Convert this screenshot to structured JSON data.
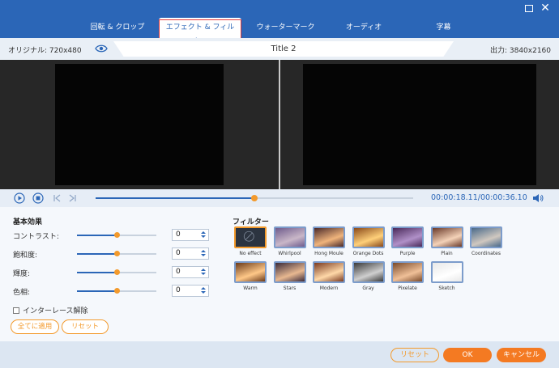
{
  "window": {
    "maximize_label": "□",
    "close_label": "✕"
  },
  "tabs": [
    {
      "label": "回転 & クロップ",
      "active": false
    },
    {
      "label": "エフェクト & フィルター",
      "active": true
    },
    {
      "label": "ウォーターマーク",
      "active": false
    },
    {
      "label": "オーディオ",
      "active": false
    },
    {
      "label": "字幕",
      "active": false
    }
  ],
  "info": {
    "original": "オリジナル: 720x480",
    "title": "Title 2",
    "output": "出力: 3840x2160"
  },
  "player": {
    "timecode": "00:00:18.11/00:00:36.10",
    "progress": 0.5
  },
  "basic": {
    "title": "基本効果",
    "adjustments": [
      {
        "label": "コントラスト:",
        "value": "0",
        "level": 0.5
      },
      {
        "label": "飽和度:",
        "value": "0",
        "level": 0.5
      },
      {
        "label": "輝度:",
        "value": "0",
        "level": 0.5
      },
      {
        "label": "色相:",
        "value": "0",
        "level": 0.5
      }
    ],
    "deinterlace_label": "インターレース解除",
    "apply_all_label": "全てに適用",
    "reset_label": "リセット"
  },
  "filters": {
    "title": "フィルター",
    "items": [
      {
        "name": "No effect",
        "selected": true,
        "colors": [
          "#2c3440",
          "#2c3440"
        ]
      },
      {
        "name": "Whirlpool",
        "selected": false,
        "colors": [
          "#6f5c8d",
          "#c9b7c8"
        ]
      },
      {
        "name": "Hong Moule",
        "selected": false,
        "colors": [
          "#4a2a2a",
          "#f0b47c"
        ]
      },
      {
        "name": "Orange Dots",
        "selected": false,
        "colors": [
          "#8a4a1a",
          "#ffd07a"
        ]
      },
      {
        "name": "Purple",
        "selected": false,
        "colors": [
          "#4a2a5a",
          "#b090c8"
        ]
      },
      {
        "name": "Plain",
        "selected": false,
        "colors": [
          "#6a3a2a",
          "#f4d2b8"
        ]
      },
      {
        "name": "Coordinates",
        "selected": false,
        "colors": [
          "#4a6a8a",
          "#d0c8c0"
        ]
      },
      {
        "name": "Warm",
        "selected": false,
        "colors": [
          "#6a3a1a",
          "#ffc888"
        ]
      },
      {
        "name": "Stars",
        "selected": false,
        "colors": [
          "#3a2a3a",
          "#e8b890"
        ]
      },
      {
        "name": "Modern",
        "selected": false,
        "colors": [
          "#7a3a20",
          "#ffd8a8"
        ]
      },
      {
        "name": "Gray",
        "selected": false,
        "colors": [
          "#3a3a3a",
          "#cfcfcf"
        ]
      },
      {
        "name": "Pixelate",
        "selected": false,
        "colors": [
          "#7a4a2a",
          "#f0c098"
        ]
      },
      {
        "name": "Sketch",
        "selected": false,
        "colors": [
          "#e8e8e8",
          "#ffffff"
        ]
      }
    ]
  },
  "footer": {
    "reset_label": "リセット",
    "ok_label": "OK",
    "cancel_label": "キャンセル"
  },
  "colors": {
    "accent": "#2b66b7",
    "orange": "#f39a2c",
    "highlight": "#e23a3a"
  }
}
